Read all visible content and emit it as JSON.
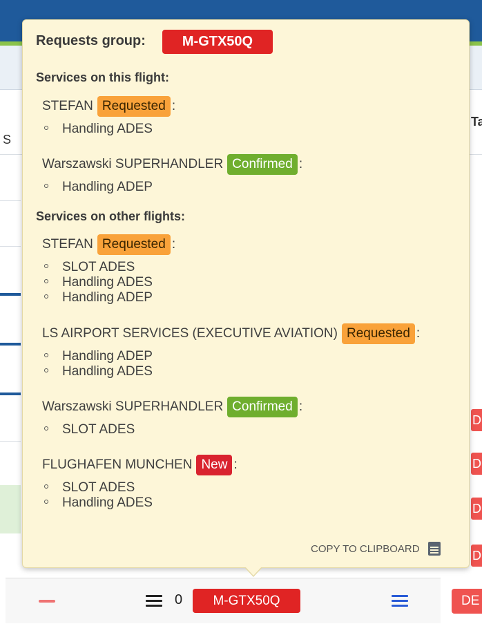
{
  "popover": {
    "title": "Requests group:",
    "group_code": "M-GTX50Q",
    "this_flight_title": "Services on this flight:",
    "other_flights_title": "Services on other flights:",
    "this_flight": [
      {
        "provider": "STEFAN",
        "status": "Requested",
        "services": [
          "Handling ADES"
        ]
      },
      {
        "provider": "Warszawski SUPERHANDLER",
        "status": "Confirmed",
        "services": [
          "Handling ADEP"
        ]
      }
    ],
    "other_flights": [
      {
        "provider": "STEFAN",
        "status": "Requested",
        "services": [
          "SLOT ADES",
          "Handling ADES",
          "Handling ADEP"
        ]
      },
      {
        "provider": "LS AIRPORT SERVICES (EXECUTIVE AVIATION)",
        "status": "Requested",
        "services": [
          "Handling ADEP",
          "Handling ADES"
        ]
      },
      {
        "provider": "Warszawski SUPERHANDLER",
        "status": "Confirmed",
        "services": [
          "SLOT ADES"
        ]
      },
      {
        "provider": "FLUGHAFEN MUNCHEN",
        "status": "New",
        "services": [
          "SLOT ADES",
          "Handling ADES"
        ]
      }
    ],
    "colon": ":",
    "copy_label": "COPY TO CLIPBOARD",
    "copy_icon": "calendar-icon"
  },
  "background": {
    "header_left_fragment": "S",
    "header_right_fragment": "Ta",
    "del_fragment": "DE"
  },
  "bottom_bar": {
    "count": "0",
    "group_code": "M-GTX50Q",
    "del_fragment": "DE"
  },
  "colors": {
    "requested": "#f9a23a",
    "confirmed": "#6fae2e",
    "new": "#d9232f",
    "group_badge": "#e02424",
    "popover_bg": "#fdf6d8"
  }
}
